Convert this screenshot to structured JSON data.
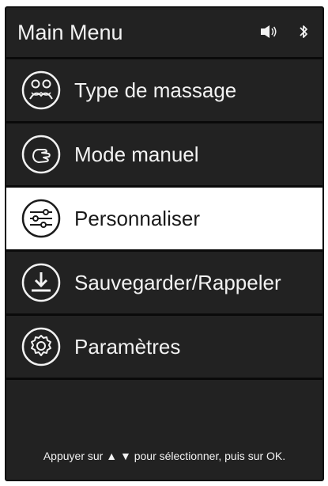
{
  "header": {
    "title": "Main Menu",
    "icons": [
      "speaker-icon",
      "bluetooth-icon"
    ]
  },
  "menu": {
    "items": [
      {
        "label": "Type de massage",
        "icon": "massage-type-icon",
        "selected": false
      },
      {
        "label": "Mode manuel",
        "icon": "manual-hand-icon",
        "selected": false
      },
      {
        "label": "Personnaliser",
        "icon": "sliders-icon",
        "selected": true
      },
      {
        "label": "Sauvegarder/Rappeler",
        "icon": "download-save-icon",
        "selected": false
      },
      {
        "label": "Paramètres",
        "icon": "gear-icon",
        "selected": false
      }
    ]
  },
  "footer": {
    "hint_prefix": "Appuyer sur",
    "up_arrow": "▲",
    "down_arrow": "▼",
    "hint_suffix": "pour sélectionner, puis sur OK."
  },
  "colors": {
    "background": "#222222",
    "selected_bg": "#ffffff",
    "text": "#f2f2f2",
    "selected_text": "#1a1a1a"
  }
}
